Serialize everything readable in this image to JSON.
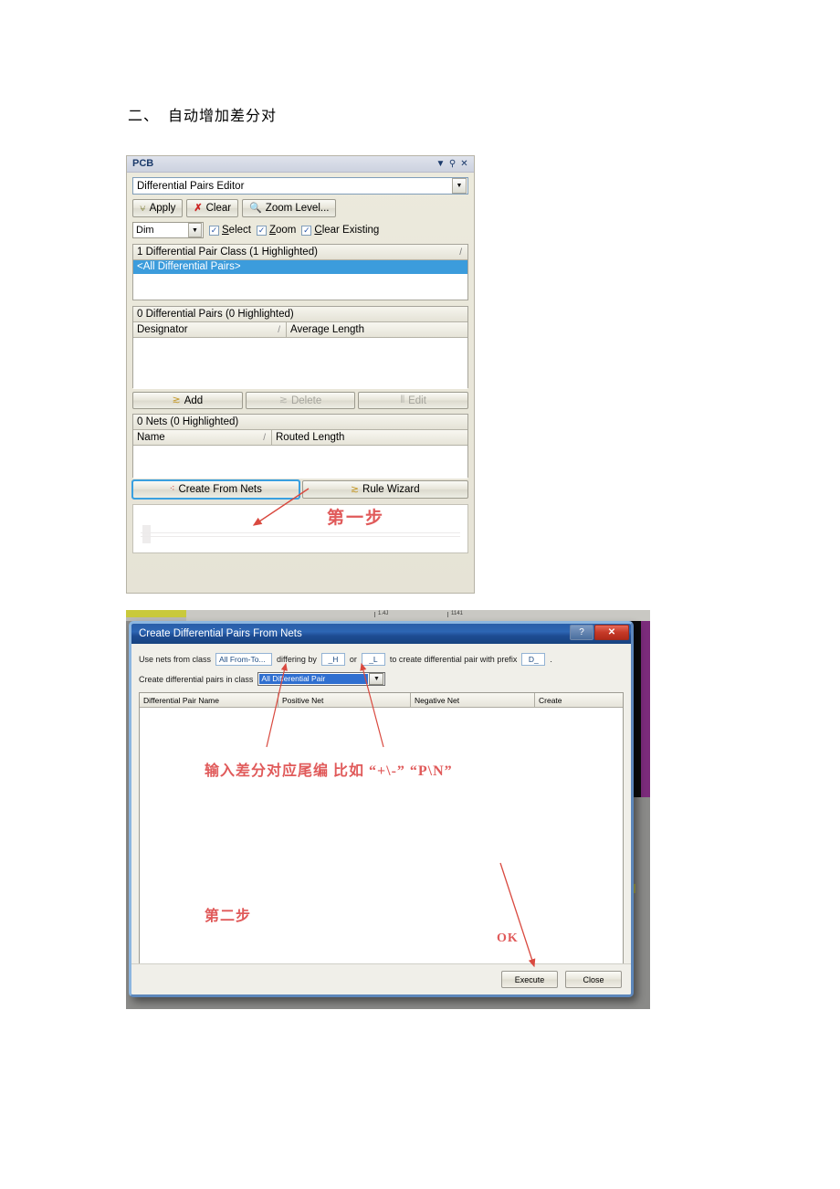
{
  "document": {
    "heading_number": "二、",
    "heading_text": "自动增加差分对"
  },
  "pcb_panel": {
    "title": "PCB",
    "titlebar_icons": [
      "chevron-down-icon",
      "pin-icon",
      "close-icon"
    ],
    "editor_select": {
      "value": "Differential Pairs Editor",
      "arrow": "▼"
    },
    "toolbar": {
      "apply_label": "Apply",
      "clear_label": "Clear",
      "zoom_level_label": "Zoom Level..."
    },
    "mask_row": {
      "mode_value": "Dim",
      "select_label": "Select",
      "select_mnemonic": "S",
      "zoom_label": "Zoom",
      "zoom_mnemonic": "Z",
      "clear_existing_label": "Clear Existing",
      "clear_existing_mnemonic": "C",
      "checked": true
    },
    "class_list": {
      "header": "1 Differential Pair Class (1 Highlighted)",
      "sort_mark": "/",
      "rows": [
        "<All Differential Pairs>"
      ]
    },
    "pairs_list": {
      "header": "0 Differential Pairs (0 Highlighted)",
      "columns": [
        "Designator",
        "Average Length"
      ],
      "sort_mark": "/",
      "rows": []
    },
    "pair_buttons": {
      "add_label": "Add",
      "delete_label": "Delete",
      "edit_label": "Edit"
    },
    "nets_list": {
      "header": "0 Nets (0 Highlighted)",
      "columns": [
        "Name",
        "Routed Length"
      ],
      "sort_mark": "/",
      "rows": []
    },
    "nets_buttons": {
      "create_from_nets_label": "Create From Nets",
      "rule_wizard_label": "Rule Wizard"
    }
  },
  "dialog": {
    "title": "Create Differential Pairs From Nets",
    "window_buttons": {
      "help": "?",
      "close": "✕"
    },
    "line1": {
      "prefix_text": "Use nets from class",
      "class_value": "All From-To...",
      "differing_text": "differing by",
      "suffix_a": "_H",
      "or_text": "or",
      "suffix_b": "_L",
      "tail_text": "to create differential pair with prefix",
      "prefix_value": "D_",
      "end_text": "."
    },
    "line2": {
      "label": "Create differential pairs in class",
      "class_value": "All Differential Pair",
      "arrow": "▼"
    },
    "grid": {
      "columns": [
        "Differential Pair Name",
        "Positive Net",
        "Negative Net",
        "Create"
      ],
      "rows": []
    },
    "footer": {
      "execute_label": "Execute",
      "close_label": "Close"
    }
  },
  "annotations": {
    "step1": "第一步",
    "step2": "第二步",
    "suffix_note": "输入差分对应尾编  比如 “+\\-”  “P\\N”",
    "ok": "OK",
    "color": "#e05a5a"
  }
}
